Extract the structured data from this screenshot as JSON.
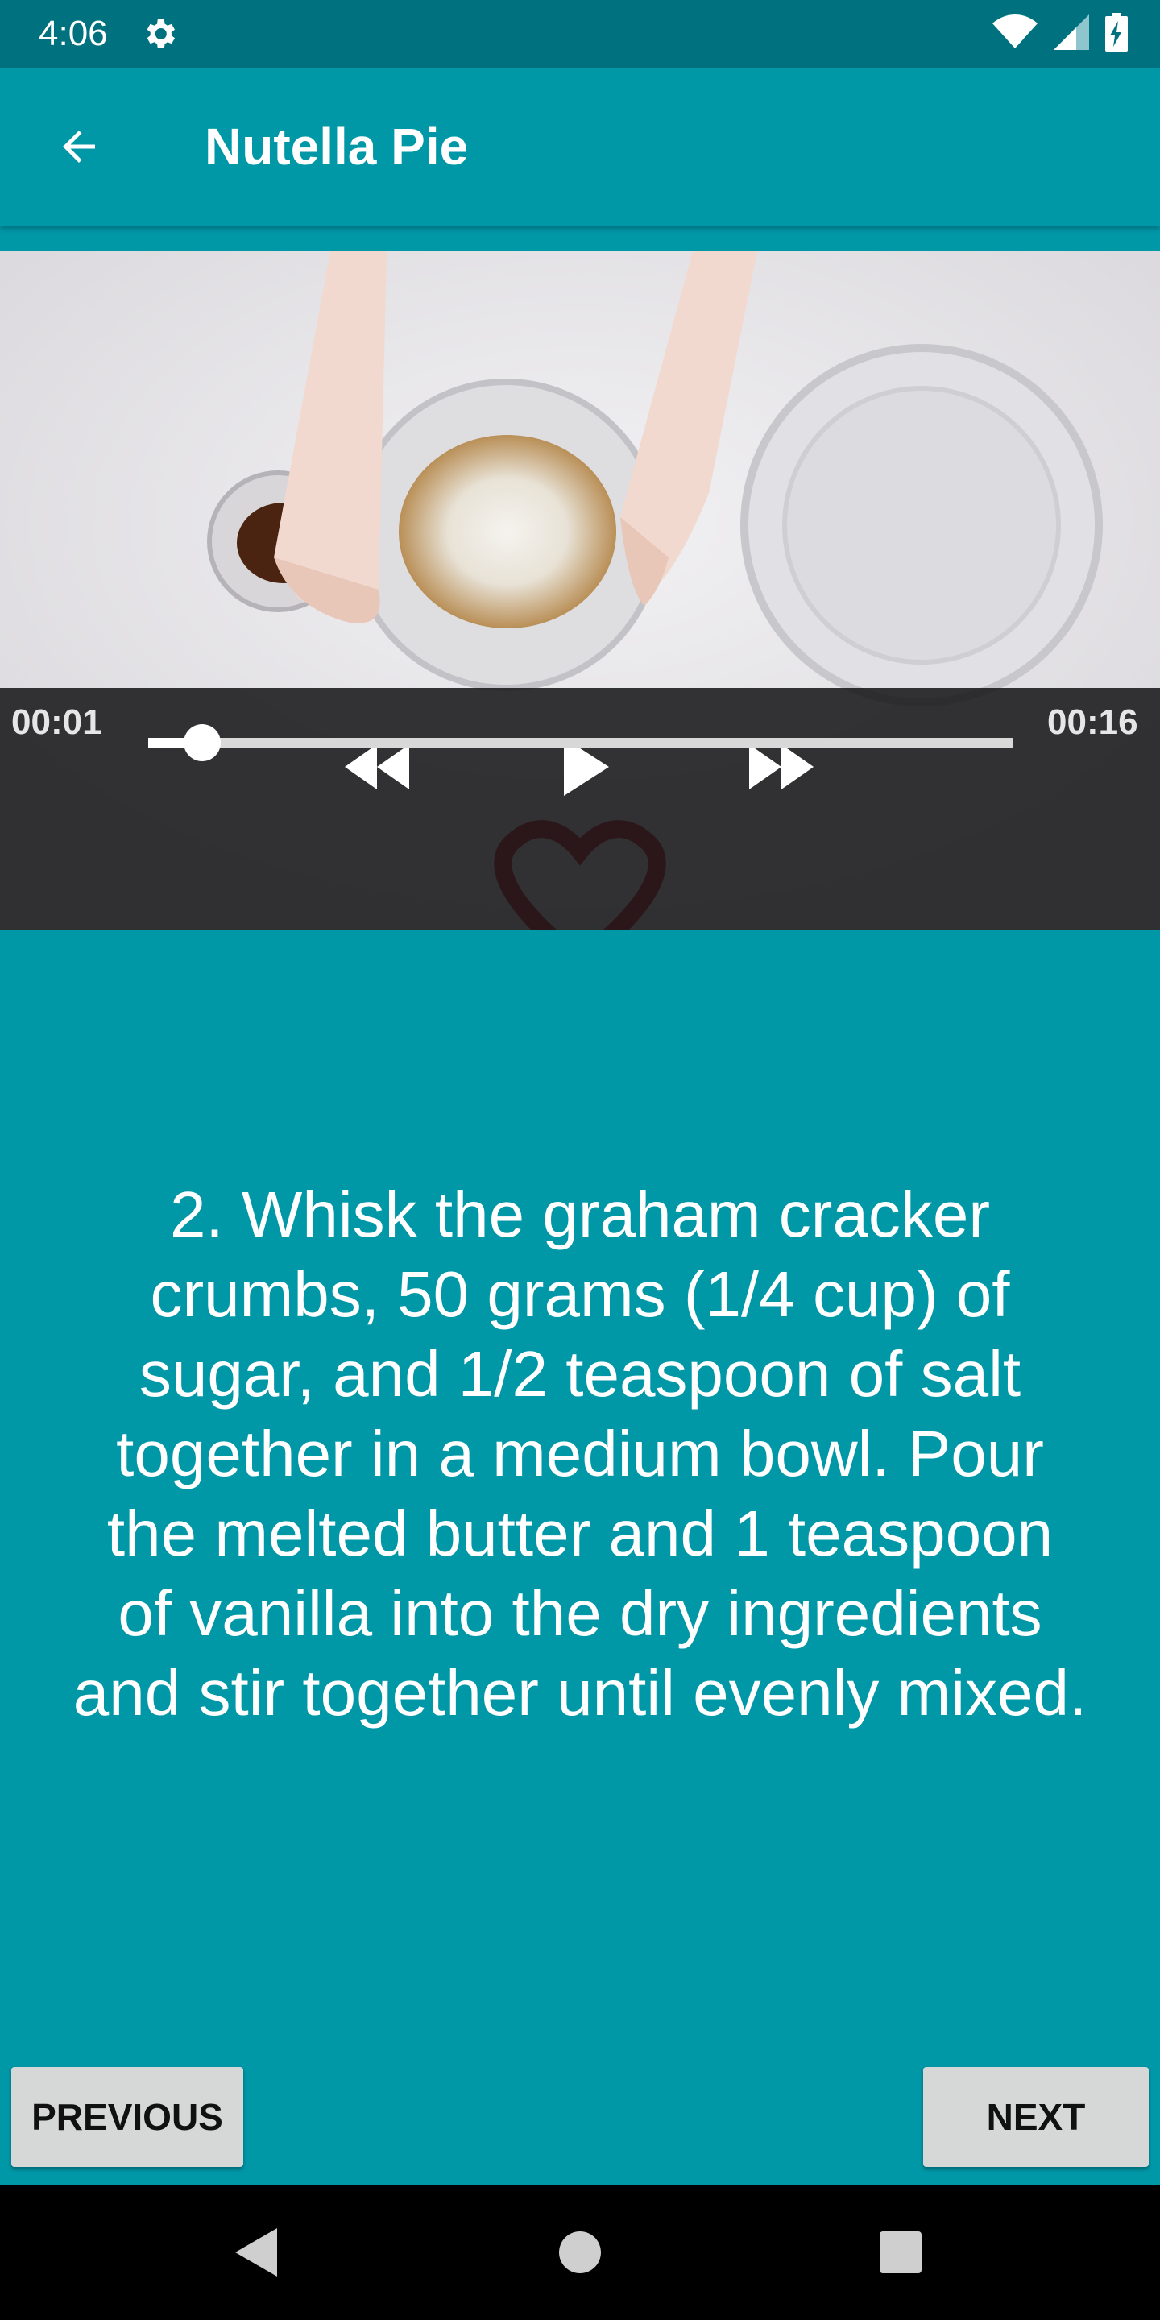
{
  "status_bar": {
    "time": "4:06",
    "icons": [
      "gear-icon",
      "wifi-icon",
      "cell-signal-icon",
      "battery-charging-icon"
    ]
  },
  "app_bar": {
    "title": "Nutella Pie",
    "back_icon": "arrow-back-icon"
  },
  "player": {
    "current_time": "00:01",
    "duration": "00:16",
    "progress": 0.0625,
    "controls": [
      "rewind-icon",
      "play-icon",
      "fast-forward-icon"
    ]
  },
  "step": {
    "description": "2. Whisk the graham cracker crumbs, 50 grams (1/4 cup) of sugar, and 1/2 teaspoon of salt together in a medium bowl. Pour the melted butter and 1 teaspoon of vanilla into the dry ingredients and stir together until evenly mixed."
  },
  "navigation": {
    "previous_label": "PREVIOUS",
    "next_label": "NEXT"
  },
  "system_nav": [
    "back-triangle-icon",
    "home-circle-icon",
    "recents-square-icon"
  ],
  "colors": {
    "status_bar": "#00727f",
    "primary": "#0097a7",
    "button": "#d6d7d7"
  }
}
